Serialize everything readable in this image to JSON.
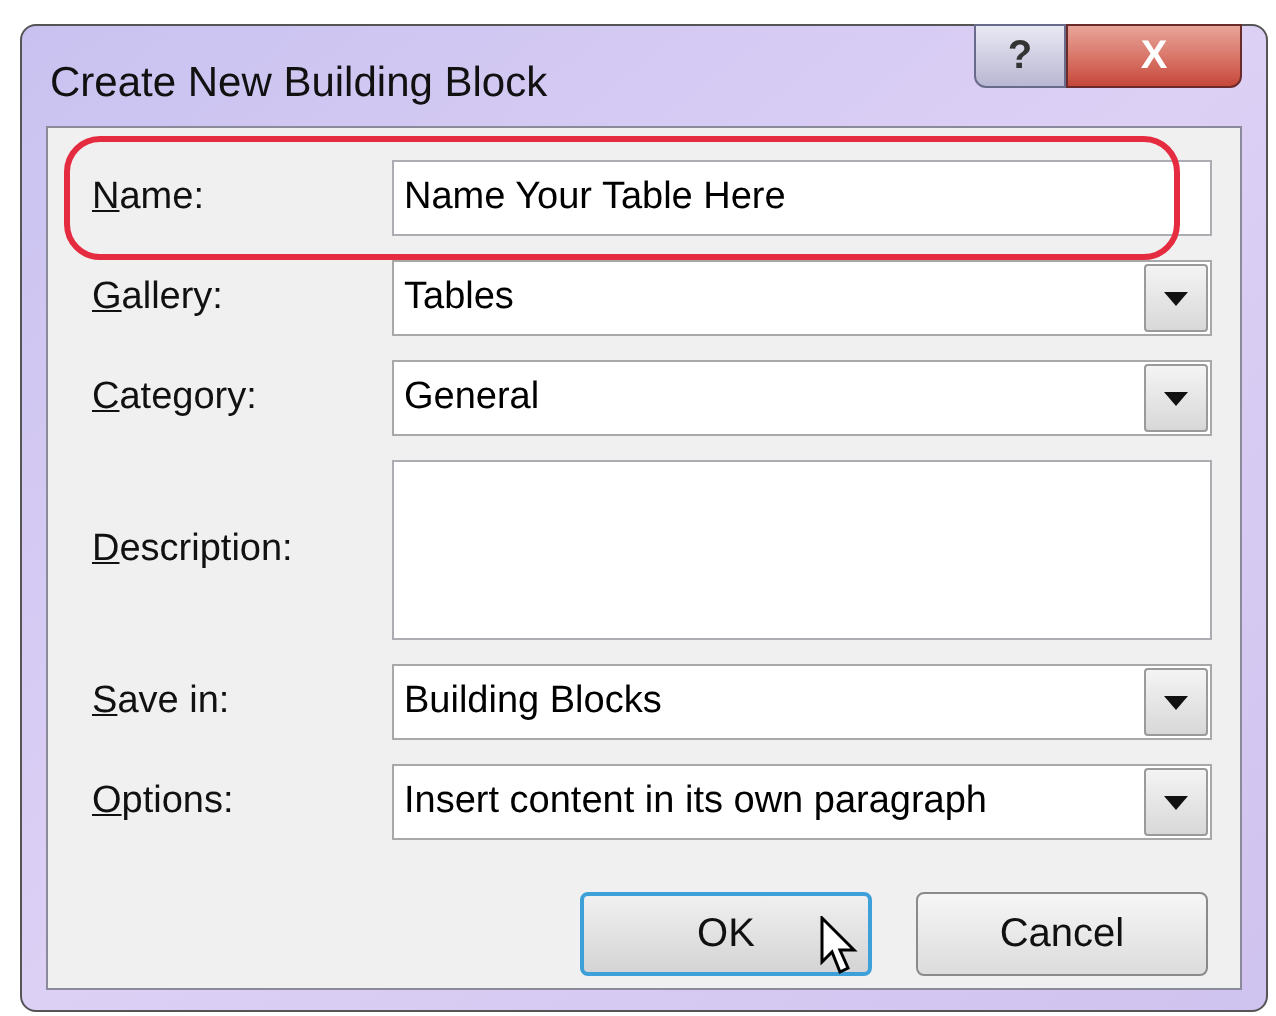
{
  "window": {
    "title": "Create New Building Block",
    "title_buttons": [
      {
        "kind": "help",
        "label": "?"
      },
      {
        "kind": "close",
        "label": "X"
      }
    ]
  },
  "fields": [
    {
      "kind": "text",
      "label": "Name:",
      "value": "Name Your Table Here",
      "highlighted": true
    },
    {
      "kind": "dropdown",
      "label": "Gallery:",
      "value": "Tables",
      "highlighted": false
    },
    {
      "kind": "dropdown",
      "label": "Category:",
      "value": "General",
      "highlighted": false
    },
    {
      "kind": "textarea",
      "label": "Description:",
      "highlighted": false
    },
    {
      "kind": "dropdown",
      "label": "Save in:",
      "value": "Building Blocks",
      "highlighted": false
    },
    {
      "kind": "dropdown",
      "label": "Options:",
      "value": "Insert content in its own paragraph",
      "highlighted": false
    }
  ],
  "buttons": [
    {
      "label": "OK",
      "default": true,
      "hovered": true
    },
    {
      "label": "Cancel",
      "default": false,
      "hovered": false
    }
  ]
}
